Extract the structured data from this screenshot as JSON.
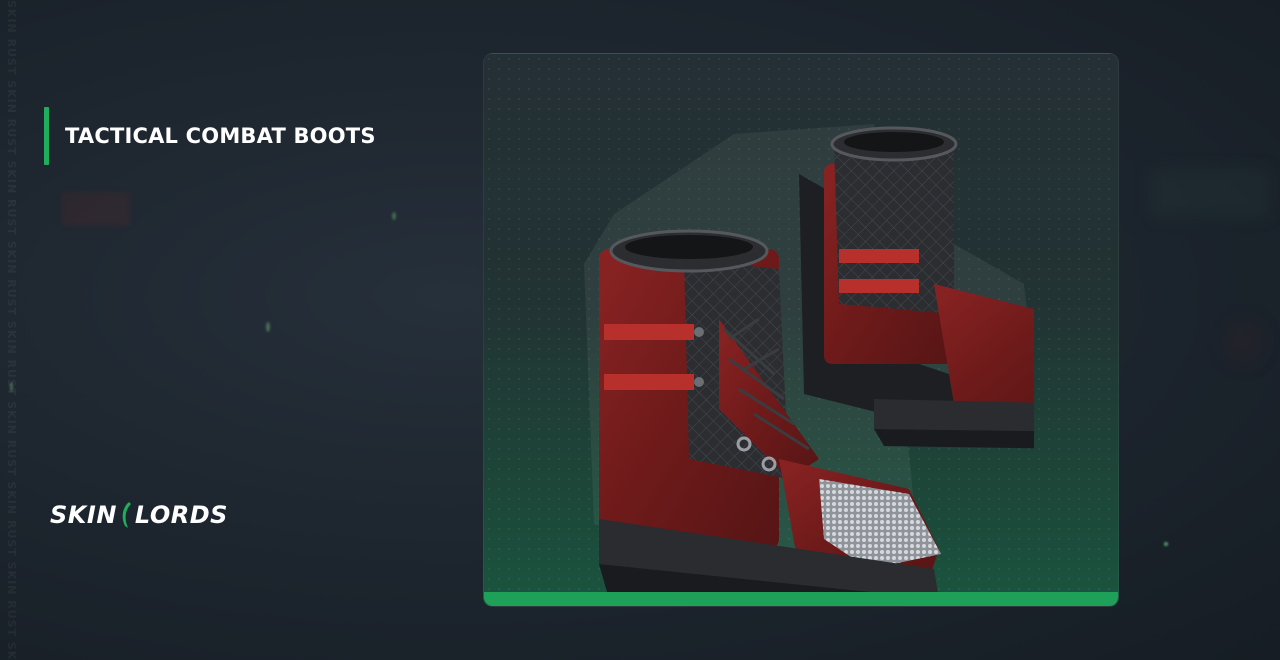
{
  "item": {
    "name": "TACTICAL COMBAT BOOTS",
    "image_icon": "combat-boots-icon"
  },
  "brand": {
    "logo_left": "SKIN",
    "logo_right": "LORDS",
    "logo_icon": "skinlords-hook-icon"
  },
  "watermark": "SKIN RUST SKIN RUST SKIN RUST SKIN RUST SKIN RUST SKIN RUST SKIN RUST SKIN RUST SKIN RUST",
  "colors": {
    "accent": "#1fae5c",
    "card_bar": "#1fa058",
    "background": "#1c242d",
    "boot_leather": "#7a1f1f",
    "boot_strap": "#b7302c"
  }
}
